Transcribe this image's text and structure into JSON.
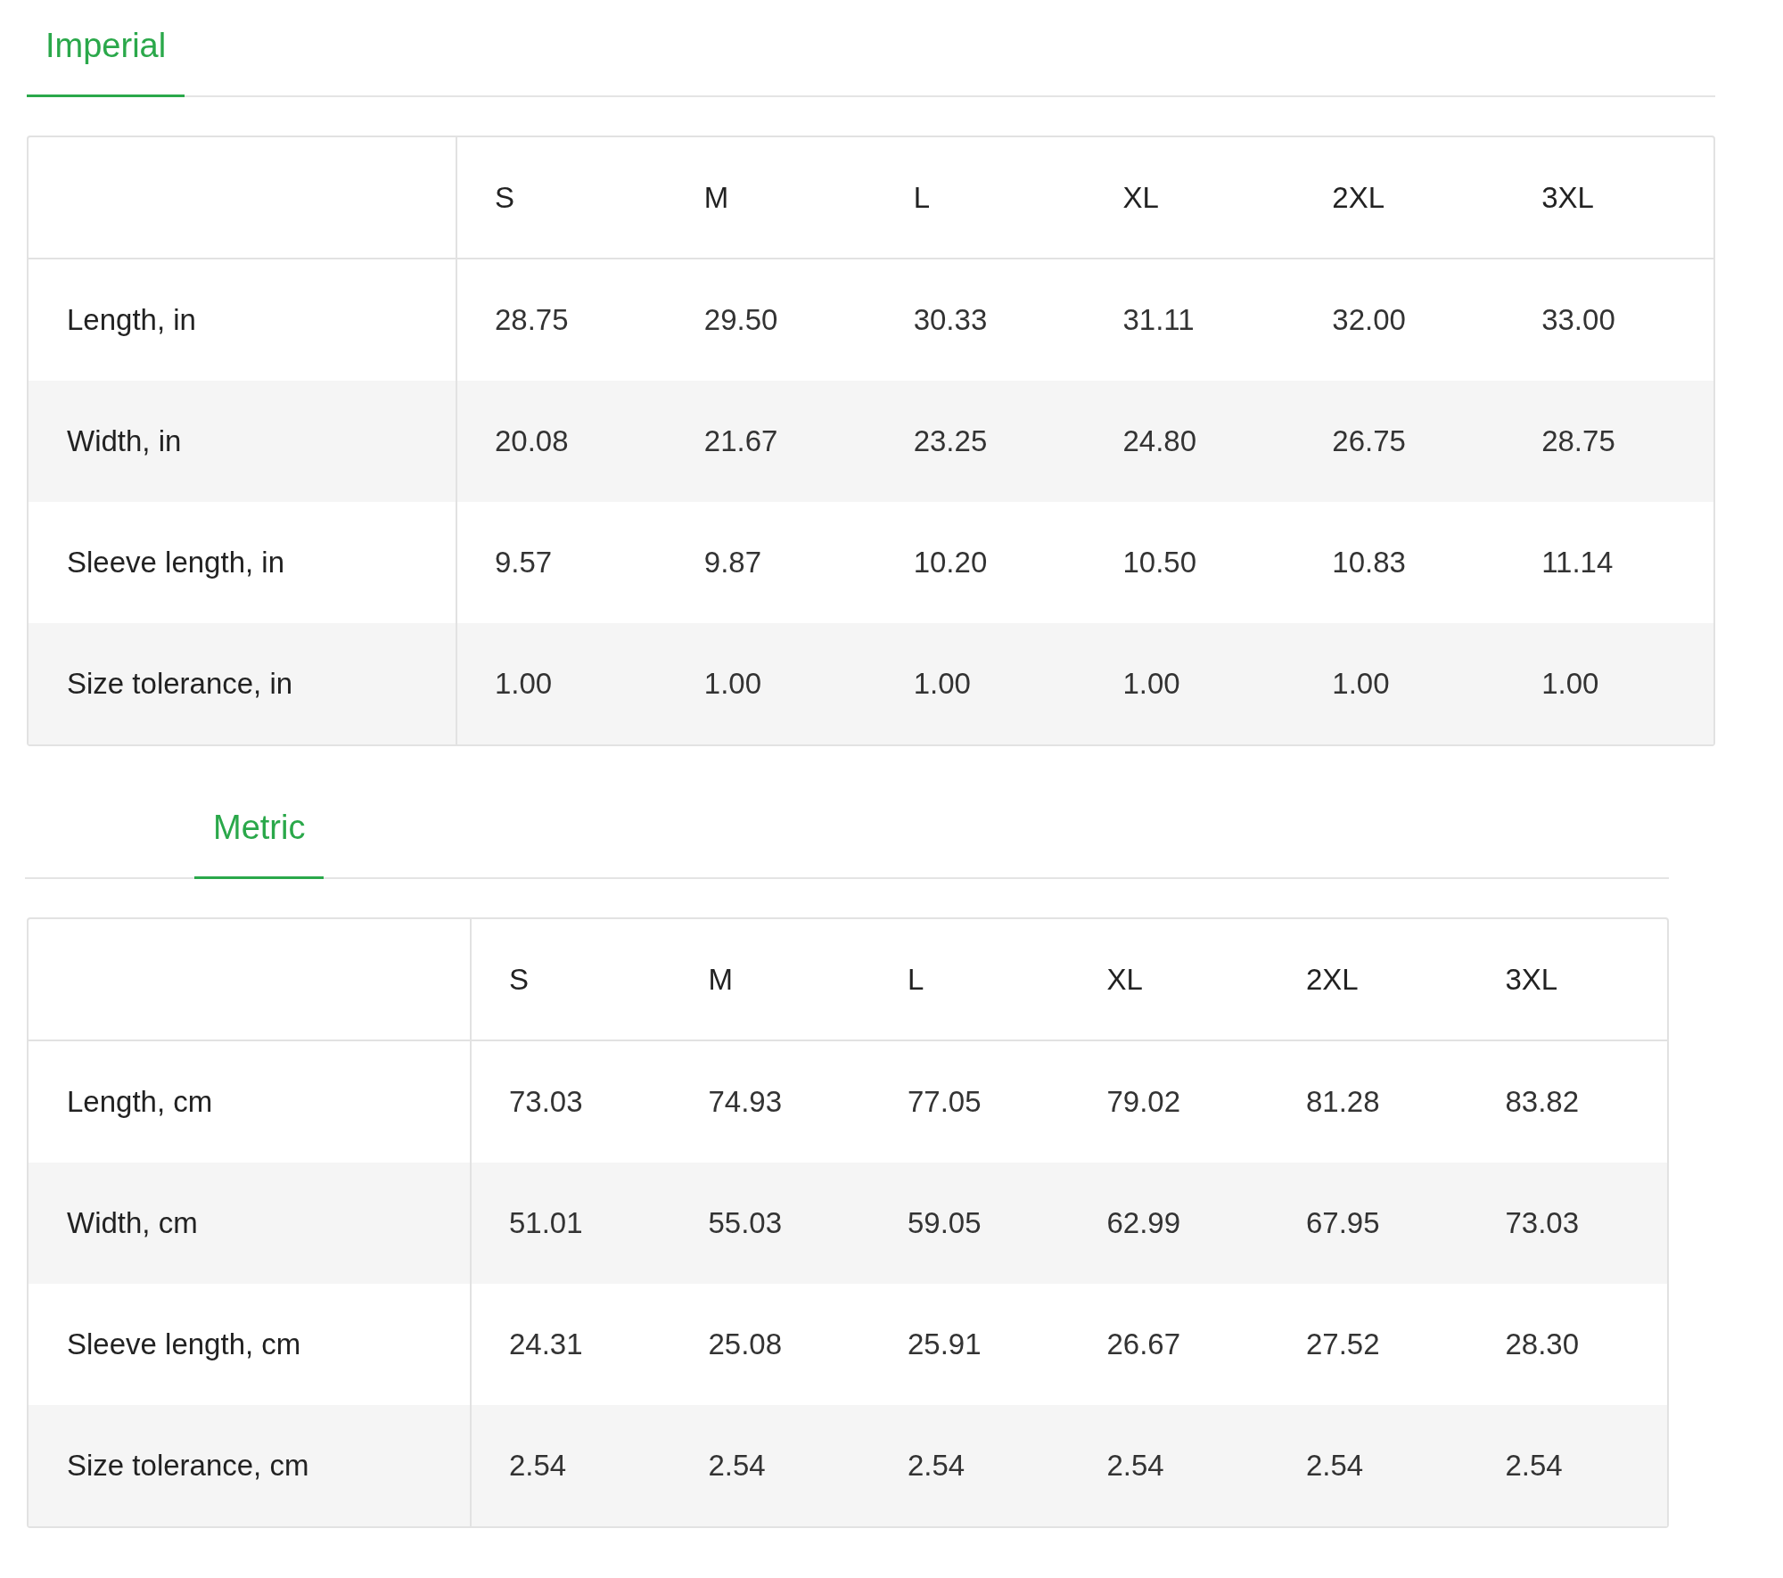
{
  "sections": [
    {
      "tab": {
        "label": "Imperial",
        "selected": true
      },
      "table": {
        "columns": [
          "S",
          "M",
          "L",
          "XL",
          "2XL",
          "3XL"
        ],
        "rows": [
          {
            "label": "Length, in",
            "cells": [
              "28.75",
              "29.50",
              "30.33",
              "31.11",
              "32.00",
              "33.00"
            ]
          },
          {
            "label": "Width, in",
            "cells": [
              "20.08",
              "21.67",
              "23.25",
              "24.80",
              "26.75",
              "28.75"
            ]
          },
          {
            "label": "Sleeve length, in",
            "cells": [
              "9.57",
              "9.87",
              "10.20",
              "10.50",
              "10.83",
              "11.14"
            ]
          },
          {
            "label": "Size tolerance, in",
            "cells": [
              "1.00",
              "1.00",
              "1.00",
              "1.00",
              "1.00",
              "1.00"
            ]
          }
        ]
      }
    },
    {
      "tab": {
        "label": "Metric",
        "selected": true
      },
      "table": {
        "columns": [
          "S",
          "M",
          "L",
          "XL",
          "2XL",
          "3XL"
        ],
        "rows": [
          {
            "label": "Length, cm",
            "cells": [
              "73.03",
              "74.93",
              "77.05",
              "79.02",
              "81.28",
              "83.82"
            ]
          },
          {
            "label": "Width, cm",
            "cells": [
              "51.01",
              "55.03",
              "59.05",
              "62.99",
              "67.95",
              "73.03"
            ]
          },
          {
            "label": "Sleeve length, cm",
            "cells": [
              "24.31",
              "25.08",
              "25.91",
              "26.67",
              "27.52",
              "28.30"
            ]
          },
          {
            "label": "Size tolerance, cm",
            "cells": [
              "2.54",
              "2.54",
              "2.54",
              "2.54",
              "2.54",
              "2.54"
            ]
          }
        ]
      }
    }
  ]
}
